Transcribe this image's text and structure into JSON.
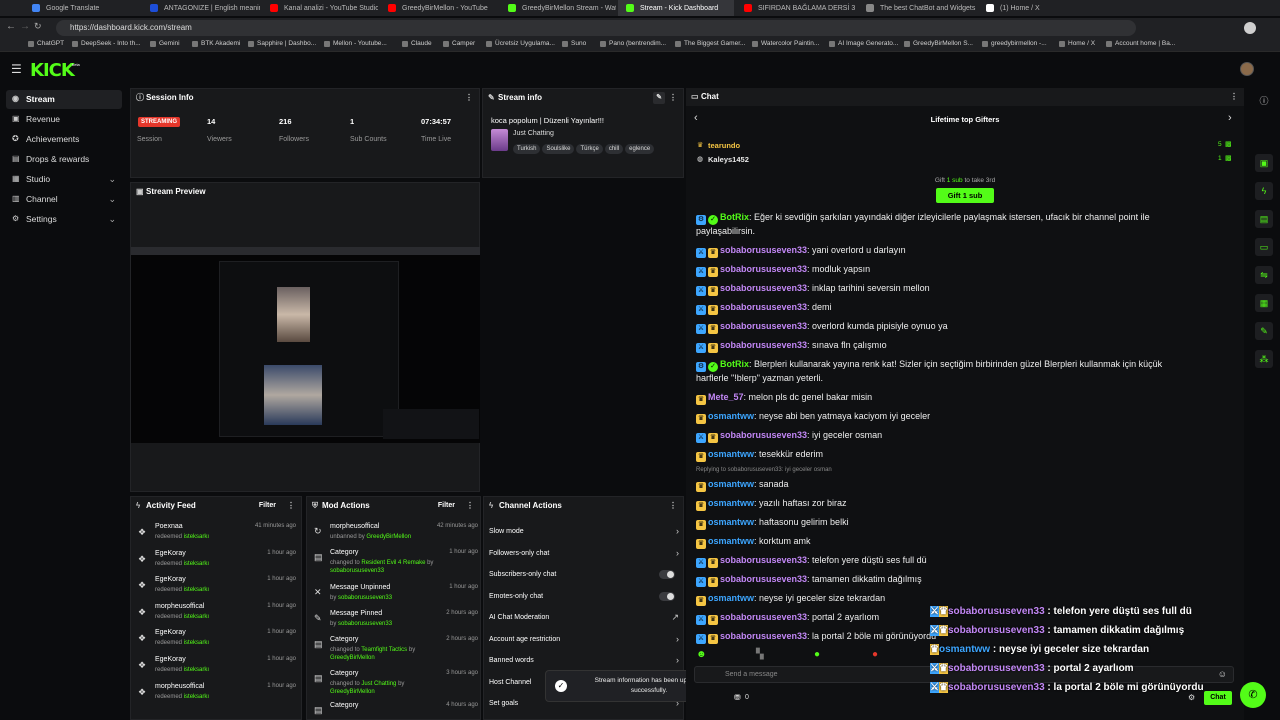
{
  "browser": {
    "tabs": [
      {
        "label": "Google Translate",
        "color": "#4285f4"
      },
      {
        "label": "ANTAGONIZE | English meaning -",
        "color": "#1d4ed8"
      },
      {
        "label": "Kanal analizi - YouTube Studio",
        "color": "#ff0000"
      },
      {
        "label": "GreedyBirMellon - YouTube",
        "color": "#ff0000"
      },
      {
        "label": "GreedyBirMellon Stream - Watch",
        "color": "#53fc18"
      },
      {
        "label": "Stream - Kick Dashboard",
        "color": "#53fc18"
      },
      {
        "label": "SIFIRDAN BAĞLAMA DERSİ 3 (EN",
        "color": "#ff0000"
      },
      {
        "label": "The best ChatBot and Widgets for",
        "color": "#888888"
      },
      {
        "label": "(1) Home / X",
        "color": "#ffffff"
      }
    ],
    "url": "https://dashboard.kick.com/stream",
    "bookmarks": [
      "ChatGPT",
      "DeepSeek - Into th...",
      "Gemini",
      "BTK Akademi",
      "Sapphire | Dashbo...",
      "Mellon - Youtube...",
      "Claude",
      "Camper",
      "Ücretsiz Uygulama...",
      "Suno",
      "Pano (bentrendim...",
      "The Biggest Gamer...",
      "Watercolor Paintin...",
      "AI Image Generato...",
      "GreedyBirMellon S...",
      "greedybirmellon -...",
      "Home / X",
      "Account home | Ba..."
    ]
  },
  "app": {
    "logo": "KICK",
    "logo_sup": "beta"
  },
  "sidebar": [
    {
      "label": "Stream",
      "icon": "signal-icon",
      "glyph": "◉",
      "active": true
    },
    {
      "label": "Revenue",
      "icon": "money-icon",
      "glyph": "▣"
    },
    {
      "label": "Achievements",
      "icon": "trophy-icon",
      "glyph": "✪"
    },
    {
      "label": "Drops & rewards",
      "icon": "gift-icon",
      "glyph": "▤"
    },
    {
      "label": "Studio",
      "icon": "studio-icon",
      "glyph": "▦",
      "expand": true
    },
    {
      "label": "Channel",
      "icon": "channel-icon",
      "glyph": "▥",
      "expand": true
    },
    {
      "label": "Settings",
      "icon": "settings-icon",
      "glyph": "⚙",
      "expand": true
    }
  ],
  "session": {
    "title": "Session Info",
    "badge": "STREAMING",
    "session_label": "Session",
    "viewers": "14",
    "viewers_label": "Viewers",
    "followers": "216",
    "followers_label": "Followers",
    "subs": "1",
    "subs_label": "Sub Counts",
    "time": "07:34:57",
    "time_label": "Time Live"
  },
  "stream_info": {
    "title": "Stream info",
    "stream_title": "koca popolum | Düzenli Yayınlar!!!",
    "category": "Just Chatting",
    "tags": [
      "Turkish",
      "Soulslike",
      "Türkçe",
      "chill",
      "eglence"
    ]
  },
  "preview": {
    "title": "Stream Preview"
  },
  "activity": {
    "title": "Activity Feed",
    "filter": "Filter",
    "items": [
      {
        "name": "Poexnaa",
        "action": "redeemed",
        "reward": "isteksarkı",
        "time": "41 minutes ago"
      },
      {
        "name": "EgeKoray",
        "action": "redeemed",
        "reward": "isteksarkı",
        "time": "1 hour ago"
      },
      {
        "name": "EgeKoray",
        "action": "redeemed",
        "reward": "isteksarkı",
        "time": "1 hour ago"
      },
      {
        "name": "morpheusoffical",
        "action": "redeemed",
        "reward": "isteksarkı",
        "time": "1 hour ago"
      },
      {
        "name": "EgeKoray",
        "action": "redeemed",
        "reward": "isteksarkı",
        "time": "1 hour ago"
      },
      {
        "name": "EgeKoray",
        "action": "redeemed",
        "reward": "isteksarkı",
        "time": "1 hour ago"
      },
      {
        "name": "morpheusoffical",
        "action": "redeemed",
        "reward": "isteksarkı",
        "time": "1 hour ago"
      }
    ]
  },
  "mod": {
    "title": "Mod Actions",
    "filter": "Filter",
    "items": [
      {
        "name": "morpheusoffical",
        "l1": "unbanned by",
        "g1": "GreedyBirMellon",
        "time": "42 minutes ago",
        "glyph": "↻"
      },
      {
        "name": "Category",
        "l1": "changed to",
        "g1": "Resident Evil 4 Remake",
        "l2": "by",
        "g2": "sobaborususeven33",
        "time": "1 hour ago",
        "glyph": "▤"
      },
      {
        "name": "Message Unpinned",
        "l1": "by",
        "g1": "sobaborususeven33",
        "time": "1 hour ago",
        "glyph": "✕"
      },
      {
        "name": "Message Pinned",
        "l1": "by",
        "g1": "sobaborususeven33",
        "time": "2 hours ago",
        "glyph": "✎"
      },
      {
        "name": "Category",
        "l1": "changed to",
        "g1": "Teamfight Tactics",
        "l2": "by",
        "g2": "GreedyBirMellon",
        "time": "2 hours ago",
        "glyph": "▤"
      },
      {
        "name": "Category",
        "l1": "changed to",
        "g1": "Just Chatting",
        "l2": "by",
        "g2": "GreedyBirMellon",
        "time": "3 hours ago",
        "glyph": "▤"
      },
      {
        "name": "Category",
        "l1": "",
        "g1": "",
        "time": "4 hours ago",
        "glyph": "▤"
      }
    ]
  },
  "channel_actions": {
    "title": "Channel Actions",
    "items": [
      {
        "label": "Slow mode",
        "kind": "arrow"
      },
      {
        "label": "Followers-only chat",
        "kind": "arrow"
      },
      {
        "label": "Subscribers-only chat",
        "kind": "toggle"
      },
      {
        "label": "Emotes-only chat",
        "kind": "toggle"
      },
      {
        "label": "AI Chat Moderation",
        "kind": "ext"
      },
      {
        "label": "Account age restriction",
        "kind": "arrow"
      },
      {
        "label": "Banned words",
        "kind": "arrow"
      },
      {
        "label": "Host Channel",
        "kind": "arrow"
      },
      {
        "label": "Set goals",
        "kind": "arrow"
      }
    ]
  },
  "toast": {
    "text": "Stream information has been updated successfully."
  },
  "chat": {
    "title": "Chat",
    "gifters_title": "Lifetime top Gifters",
    "gifters": [
      {
        "name": "tearundo",
        "count": "5",
        "color": "#f5c543"
      },
      {
        "name": "Kaleys1452",
        "count": "1",
        "color": "#e8e8e8"
      }
    ],
    "gift_hint_a": "Gift",
    "gift_hint_b": "1 sub",
    "gift_hint_c": "to take 3rd",
    "gift_button": "Gift 1 sub",
    "input_placeholder": "Send a message",
    "send_label": "Chat",
    "points": "0",
    "messages": [
      {
        "u": "BotRix",
        "c": "#53fc18",
        "t": ": Eğer ki sevdiğin şarkıları yayındaki diğer izleyicilerle paylaşmak istersen, ufacık bir channel point ile",
        "cont": "paylaşabilirsin.",
        "badge": "bot"
      },
      {
        "u": "sobaborususeven33",
        "c": "#c287f5",
        "t": ": yani overlord u darlayın",
        "badge": "mod"
      },
      {
        "u": "sobaborususeven33",
        "c": "#c287f5",
        "t": ": modluk yapsın",
        "badge": "mod"
      },
      {
        "u": "sobaborususeven33",
        "c": "#c287f5",
        "t": ": inklap tarihini seversin mellon",
        "badge": "mod"
      },
      {
        "u": "sobaborususeven33",
        "c": "#c287f5",
        "t": ": demi",
        "badge": "mod"
      },
      {
        "u": "sobaborususeven33",
        "c": "#c287f5",
        "t": ": overlord kumda pipisiyle oynuo ya",
        "badge": "mod"
      },
      {
        "u": "sobaborususeven33",
        "c": "#c287f5",
        "t": ": sınava fln çalışmıo",
        "badge": "mod"
      },
      {
        "u": "BotRix",
        "c": "#53fc18",
        "t": ": Blerpleri kullanarak yayına renk kat! Sizler için seçtiğim birbirinden güzel Blerpleri kullanmak için küçük",
        "cont": "harflerle \"!blerp\" yazman yeterli.",
        "badge": "bot"
      },
      {
        "u": "Mete_57",
        "c": "#c287f5",
        "t": ": melon pls dc genel bakar misin",
        "badge": "sub"
      },
      {
        "u": "osmantww",
        "c": "#3da6ff",
        "t": ": neyse abi ben yatmaya kaciyom iyi geceler",
        "badge": "sub"
      },
      {
        "u": "sobaborususeven33",
        "c": "#c287f5",
        "t": ": iyi geceler osman",
        "badge": "mod"
      },
      {
        "u": "osmantww",
        "c": "#3da6ff",
        "t": ": tesekkür ederim",
        "badge": "sub"
      },
      {
        "u": "osmantww",
        "c": "#3da6ff",
        "t": ": sanada",
        "badge": "sub",
        "reply": "Replying to sobaborususeven33: iyi geceler osman"
      },
      {
        "u": "osmantww",
        "c": "#3da6ff",
        "t": ": yazılı haftası zor biraz",
        "badge": "sub"
      },
      {
        "u": "osmantww",
        "c": "#3da6ff",
        "t": ": haftasonu gelirim belki",
        "badge": "sub"
      },
      {
        "u": "osmantww",
        "c": "#3da6ff",
        "t": ": korktum amk",
        "badge": "sub"
      },
      {
        "u": "sobaborususeven33",
        "c": "#c287f5",
        "t": ": telefon yere düştü ses full dü",
        "badge": "mod"
      },
      {
        "u": "sobaborususeven33",
        "c": "#c287f5",
        "t": ": tamamen dikkatim dağılmış",
        "badge": "mod"
      },
      {
        "u": "osmantww",
        "c": "#3da6ff",
        "t": ": neyse iyi geceler size tekrardan",
        "badge": "sub"
      },
      {
        "u": "sobaborususeven33",
        "c": "#c287f5",
        "t": ": portal 2 ayarlıom",
        "badge": "mod"
      },
      {
        "u": "sobaborususeven33",
        "c": "#c287f5",
        "t": ": la portal 2 böle mi görünüyordu",
        "badge": "mod"
      }
    ]
  },
  "overlay": [
    {
      "u": "sobaborususeven33",
      "c": "#c287f5",
      "t": " : telefon yere düştü ses full dü",
      "badge": "mod"
    },
    {
      "u": "sobaborususeven33",
      "c": "#c287f5",
      "t": " : tamamen dikkatim dağılmış",
      "badge": "mod"
    },
    {
      "u": "osmantww",
      "c": "#3da6ff",
      "t": " : neyse iyi geceler size tekrardan",
      "badge": "sub"
    },
    {
      "u": "sobaborususeven33",
      "c": "#c287f5",
      "t": " : portal 2 ayarlıom",
      "badge": "mod"
    },
    {
      "u": "sobaborususeven33",
      "c": "#c287f5",
      "t": " : la portal 2 böle mi görünüyordu",
      "badge": "mod"
    }
  ],
  "right_tools": [
    "info-icon",
    "layout-icon",
    "bolt-icon",
    "clipboard-icon",
    "chat-icon",
    "broadcast-icon",
    "store-icon",
    "wrench-icon",
    "share-icon"
  ]
}
